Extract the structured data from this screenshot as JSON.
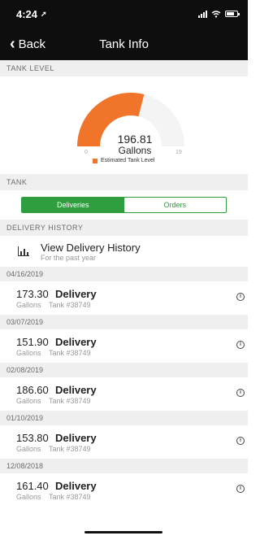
{
  "status_bar": {
    "time": "4:24",
    "location_arrow": "location-arrow-icon",
    "battery_level": 0.75
  },
  "nav": {
    "back_label": "Back",
    "title": "Tank Info"
  },
  "tank_level": {
    "section_label": "TANK LEVEL",
    "value": "196.81",
    "unit": "Gallons",
    "min_label": "0",
    "max_label": "19",
    "legend": "Estimated Tank Level",
    "fill_color": "#f0752a",
    "fill_fraction": 0.58
  },
  "tank": {
    "section_label": "TANK",
    "segments": [
      {
        "label": "Deliveries",
        "active": true
      },
      {
        "label": "Orders",
        "active": false
      }
    ]
  },
  "delivery_history": {
    "section_label": "DELIVERY HISTORY",
    "link_title": "View Delivery History",
    "link_subtitle": "For the past year",
    "entries": [
      {
        "date": "04/16/2019",
        "amount": "173.30",
        "unit": "Gallons",
        "type": "Delivery",
        "tank": "Tank #38749"
      },
      {
        "date": "03/07/2019",
        "amount": "151.90",
        "unit": "Gallons",
        "type": "Delivery",
        "tank": "Tank #38749"
      },
      {
        "date": "02/08/2019",
        "amount": "186.60",
        "unit": "Gallons",
        "type": "Delivery",
        "tank": "Tank #38749"
      },
      {
        "date": "01/10/2019",
        "amount": "153.80",
        "unit": "Gallons",
        "type": "Delivery",
        "tank": "Tank #38749"
      },
      {
        "date": "12/08/2018",
        "amount": "161.40",
        "unit": "Gallons",
        "type": "Delivery",
        "tank": "Tank #38749"
      }
    ]
  },
  "colors": {
    "accent_green": "#2f9e3f",
    "gauge_orange": "#f0752a",
    "nav_bg": "#0e0e0e",
    "section_bg": "#efeff0"
  }
}
